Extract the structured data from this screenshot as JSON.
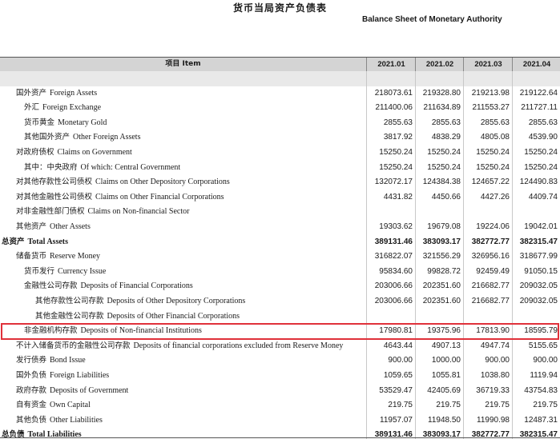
{
  "title_cn": "货币当局资产负债表",
  "title_en": "Balance Sheet of Monetary Authority",
  "columns": [
    "2021.01",
    "2021.02",
    "2021.03",
    "2021.04"
  ],
  "header_item": "项目 Item",
  "rows": [
    {
      "cn": "",
      "en": "",
      "indent": 0,
      "bold": false,
      "values": [
        "",
        "",
        "",
        ""
      ],
      "shade": true
    },
    {
      "cn": "国外资产",
      "en": "Foreign Assets",
      "indent": 1,
      "bold": false,
      "values": [
        "218073.61",
        "219328.80",
        "219213.98",
        "219122.64"
      ]
    },
    {
      "cn": "外汇",
      "en": "Foreign Exchange",
      "indent": 2,
      "bold": false,
      "values": [
        "211400.06",
        "211634.89",
        "211553.27",
        "211727.11"
      ]
    },
    {
      "cn": "货币黄金",
      "en": "Monetary Gold",
      "indent": 2,
      "bold": false,
      "values": [
        "2855.63",
        "2855.63",
        "2855.63",
        "2855.63"
      ]
    },
    {
      "cn": "其他国外资产",
      "en": "Other Foreign Assets",
      "indent": 2,
      "bold": false,
      "values": [
        "3817.92",
        "4838.29",
        "4805.08",
        "4539.90"
      ]
    },
    {
      "cn": "对政府债权",
      "en": "Claims on Government",
      "indent": 1,
      "bold": false,
      "values": [
        "15250.24",
        "15250.24",
        "15250.24",
        "15250.24"
      ]
    },
    {
      "cn": "其中：中央政府",
      "en": "Of which: Central Government",
      "indent": 2,
      "bold": false,
      "values": [
        "15250.24",
        "15250.24",
        "15250.24",
        "15250.24"
      ]
    },
    {
      "cn": "对其他存款性公司债权",
      "en": "Claims on Other Depository Corporations",
      "indent": 1,
      "bold": false,
      "values": [
        "132072.17",
        "124384.38",
        "124657.22",
        "124490.83"
      ]
    },
    {
      "cn": "对其他金融性公司债权",
      "en": "Claims on Other Financial Corporations",
      "indent": 1,
      "bold": false,
      "values": [
        "4431.82",
        "4450.66",
        "4427.26",
        "4409.74"
      ]
    },
    {
      "cn": "对非金融性部门债权",
      "en": "Claims on Non-financial Sector",
      "indent": 1,
      "bold": false,
      "values": [
        "",
        "",
        "",
        ""
      ]
    },
    {
      "cn": "其他资产",
      "en": "Other Assets",
      "indent": 1,
      "bold": false,
      "values": [
        "19303.62",
        "19679.08",
        "19224.06",
        "19042.01"
      ]
    },
    {
      "cn": "总资产",
      "en": "Total Assets",
      "indent": 0,
      "bold": true,
      "values": [
        "389131.46",
        "383093.17",
        "382772.77",
        "382315.47"
      ]
    },
    {
      "cn": "储备货币",
      "en": "Reserve Money",
      "indent": 1,
      "bold": false,
      "values": [
        "316822.07",
        "321556.29",
        "326956.16",
        "318677.99"
      ]
    },
    {
      "cn": "货币发行",
      "en": "Currency Issue",
      "indent": 2,
      "bold": false,
      "values": [
        "95834.60",
        "99828.72",
        "92459.49",
        "91050.15"
      ]
    },
    {
      "cn": "金融性公司存款",
      "en": "Deposits of Financial Corporations",
      "indent": 2,
      "bold": false,
      "values": [
        "203006.66",
        "202351.60",
        "216682.77",
        "209032.05"
      ]
    },
    {
      "cn": "其他存款性公司存款",
      "en": "Deposits of Other Depository Corporations",
      "indent": 3,
      "bold": false,
      "values": [
        "203006.66",
        "202351.60",
        "216682.77",
        "209032.05"
      ]
    },
    {
      "cn": "其他金融性公司存款",
      "en": "Deposits of Other Financial Corporations",
      "indent": 3,
      "bold": false,
      "values": [
        "",
        "",
        "",
        ""
      ]
    },
    {
      "cn": "非金融机构存款",
      "en": "Deposits of Non-financial Institutions",
      "indent": 2,
      "bold": false,
      "values": [
        "17980.81",
        "19375.96",
        "17813.90",
        "18595.79"
      ],
      "highlight": true
    },
    {
      "cn": "不计入储备货币的金融性公司存款",
      "en": "Deposits of financial corporations excluded from Reserve Money",
      "indent": 1,
      "bold": false,
      "values": [
        "4643.44",
        "4907.13",
        "4947.74",
        "5155.65"
      ]
    },
    {
      "cn": "发行债券",
      "en": "Bond Issue",
      "indent": 1,
      "bold": false,
      "values": [
        "900.00",
        "1000.00",
        "900.00",
        "900.00"
      ]
    },
    {
      "cn": "国外负债",
      "en": "Foreign Liabilities",
      "indent": 1,
      "bold": false,
      "values": [
        "1059.65",
        "1055.81",
        "1038.80",
        "1119.94"
      ]
    },
    {
      "cn": "政府存款",
      "en": "Deposits of Government",
      "indent": 1,
      "bold": false,
      "values": [
        "53529.47",
        "42405.69",
        "36719.33",
        "43754.83"
      ]
    },
    {
      "cn": "自有资金",
      "en": "Own Capital",
      "indent": 1,
      "bold": false,
      "values": [
        "219.75",
        "219.75",
        "219.75",
        "219.75"
      ]
    },
    {
      "cn": "其他负债",
      "en": "Other Liabilities",
      "indent": 1,
      "bold": false,
      "values": [
        "11957.07",
        "11948.50",
        "11990.98",
        "12487.31"
      ]
    },
    {
      "cn": "总负债",
      "en": "Total Liabilities",
      "indent": 0,
      "bold": true,
      "values": [
        "389131.46",
        "383093.17",
        "382772.77",
        "382315.47"
      ]
    }
  ]
}
